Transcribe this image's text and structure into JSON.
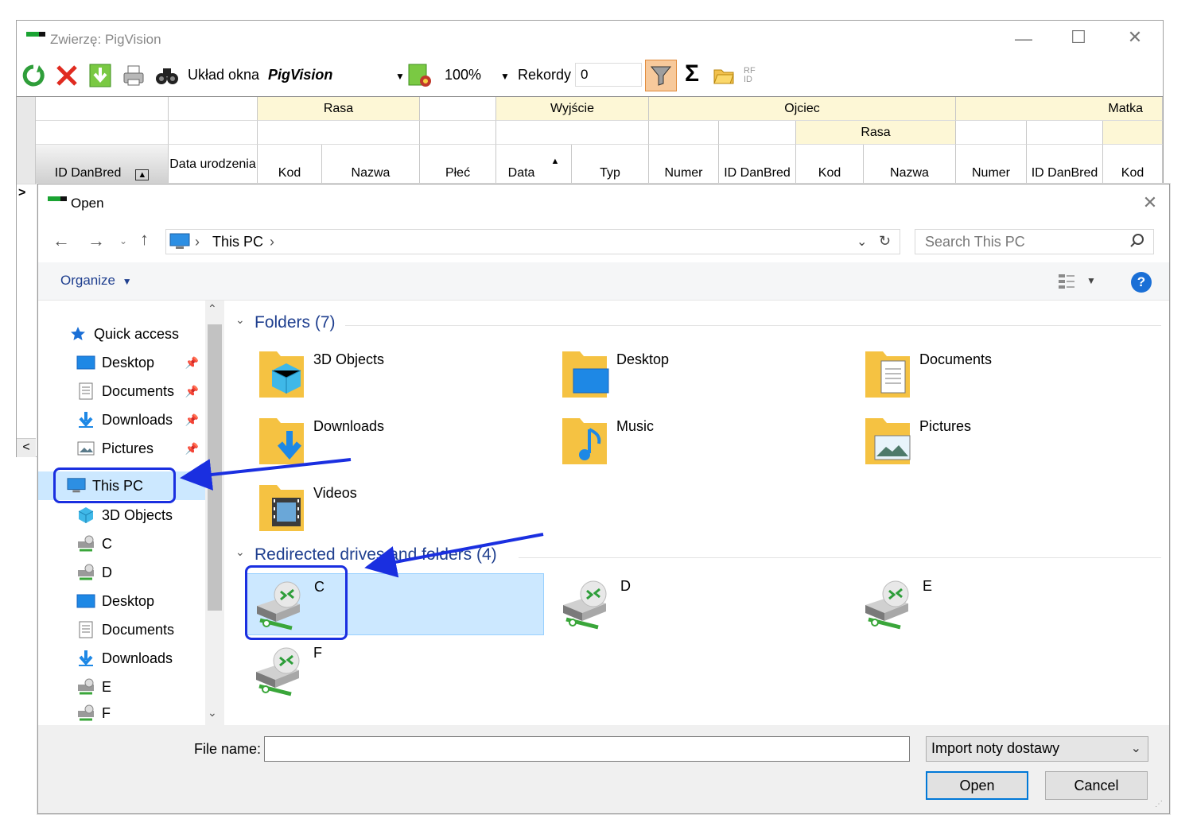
{
  "bg_window": {
    "title": "Zwierzę: PigVision",
    "toolbar": {
      "layout_label": "Układ okna",
      "layout_value": "PigVision",
      "zoom_value": "100%",
      "records_label": "Rekordy",
      "records_value": "0",
      "sigma": "Σ",
      "rfid": "RF ID"
    },
    "grid": {
      "group_rasa": "Rasa",
      "group_wyjscie": "Wyjście",
      "group_ojciec": "Ojciec",
      "group_matka": "Matka",
      "sub_rasa": "Rasa",
      "cols": {
        "id_danbred": "ID DanBred",
        "data_urodzenia": "Data urodzenia",
        "kod": "Kod",
        "nazwa": "Nazwa",
        "plec": "Płeć",
        "data": "Data",
        "typ": "Typ",
        "numer": "Numer",
        "o_id_danbred": "ID DanBred",
        "o_kod": "Kod",
        "o_nazwa": "Nazwa",
        "m_numer": "Numer",
        "m_id_danbred": "ID DanBred",
        "m_kod": "Kod"
      },
      "row_marker": ">",
      "scroll_left": "<"
    }
  },
  "dialog": {
    "title": "Open",
    "address": {
      "location": "This PC",
      "sep": "›"
    },
    "search_placeholder": "Search This PC",
    "organize_label": "Organize",
    "help": "?",
    "nav": {
      "quick_access": "Quick access",
      "desktop": "Desktop",
      "documents": "Documents",
      "downloads": "Downloads",
      "pictures": "Pictures",
      "this_pc": "This PC",
      "objects_3d": "3D Objects",
      "drive_c": "C",
      "drive_d": "D",
      "desktop2": "Desktop",
      "documents2": "Documents",
      "downloads2": "Downloads",
      "drive_e": "E",
      "drive_f": "F"
    },
    "folders_header": "Folders (7)",
    "folders": {
      "objects_3d": "3D Objects",
      "desktop": "Desktop",
      "documents": "Documents",
      "downloads": "Downloads",
      "music": "Music",
      "pictures": "Pictures",
      "videos": "Videos"
    },
    "drives_header": "Redirected drives and folders (4)",
    "drives": {
      "c": "C",
      "d": "D",
      "e": "E",
      "f": "F"
    },
    "file_name_label": "File name:",
    "file_name_value": "",
    "filter_value": "Import noty dostawy",
    "open_button": "Open",
    "cancel_button": "Cancel"
  },
  "colors": {
    "annotation": "#1a2fe0",
    "selection": "#cce8ff",
    "group_header": "#1f3f8f",
    "grid_header_yellow": "#fdf7d6"
  }
}
